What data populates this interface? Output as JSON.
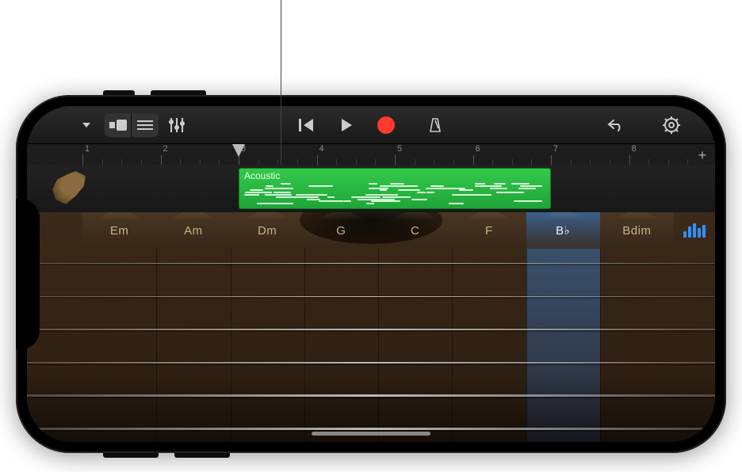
{
  "controlbar": {
    "browser_tip": "▾",
    "view_toggle_tip": "⧉",
    "fx_tip": "≡",
    "track_controls_tip": "sliders",
    "go_start_tip": "◀◀",
    "play_tip": "▶",
    "record_tip": "●",
    "metronome_tip": "metronome",
    "undo_tip": "↶",
    "settings_tip": "⚙"
  },
  "ruler": {
    "bars": [
      "1",
      "2",
      "3",
      "4",
      "5",
      "6",
      "7",
      "8"
    ],
    "playhead_bar": 3,
    "add_tip": "+"
  },
  "track": {
    "instrument_name": "Acoustic Guitar",
    "region_label": "Acoustic",
    "region_start_bar": 3,
    "region_end_bar": 7
  },
  "instrument": {
    "chords": [
      "Em",
      "Am",
      "Dm",
      "G",
      "C",
      "F",
      "B♭",
      "Bdim"
    ],
    "active_chord": "B♭",
    "autoplay_tip": "Autoplay",
    "string_count": 6
  },
  "colors": {
    "region_green": "#2fb841",
    "record_red": "#ff3b30",
    "accent_blue": "#2f8fff"
  }
}
